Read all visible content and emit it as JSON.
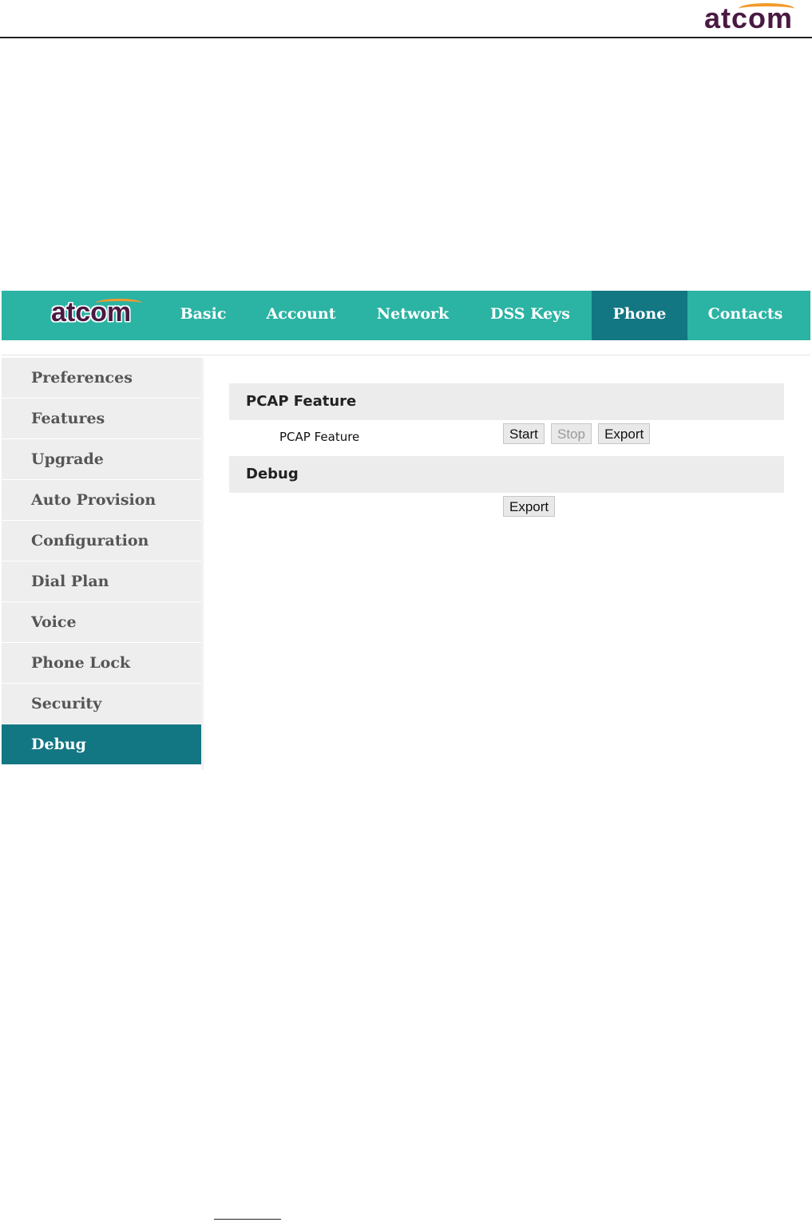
{
  "doc_header": {
    "logo_text": "atcom"
  },
  "nav": {
    "logo_text": "atcom",
    "tabs": [
      {
        "label": "Basic"
      },
      {
        "label": "Account"
      },
      {
        "label": "Network"
      },
      {
        "label": "DSS Keys"
      },
      {
        "label": "Phone",
        "active": true
      },
      {
        "label": "Contacts"
      }
    ]
  },
  "sidebar": {
    "items": [
      {
        "label": "Preferences"
      },
      {
        "label": "Features"
      },
      {
        "label": "Upgrade"
      },
      {
        "label": "Auto Provision"
      },
      {
        "label": "Configuration"
      },
      {
        "label": "Dial Plan"
      },
      {
        "label": "Voice"
      },
      {
        "label": "Phone Lock"
      },
      {
        "label": "Security"
      },
      {
        "label": "Debug",
        "active": true
      }
    ]
  },
  "pcap": {
    "section_title": "PCAP Feature",
    "row_label": "PCAP Feature",
    "start_label": "Start",
    "stop_label": "Stop",
    "stop_disabled": true,
    "export_label": "Export"
  },
  "debug": {
    "section_title": "Debug",
    "export_label": "Export"
  },
  "colors": {
    "nav_bg": "#2bb3a3",
    "active_bg": "#137683",
    "logo_purple": "#4a1942",
    "logo_orange": "#f39a2b"
  }
}
